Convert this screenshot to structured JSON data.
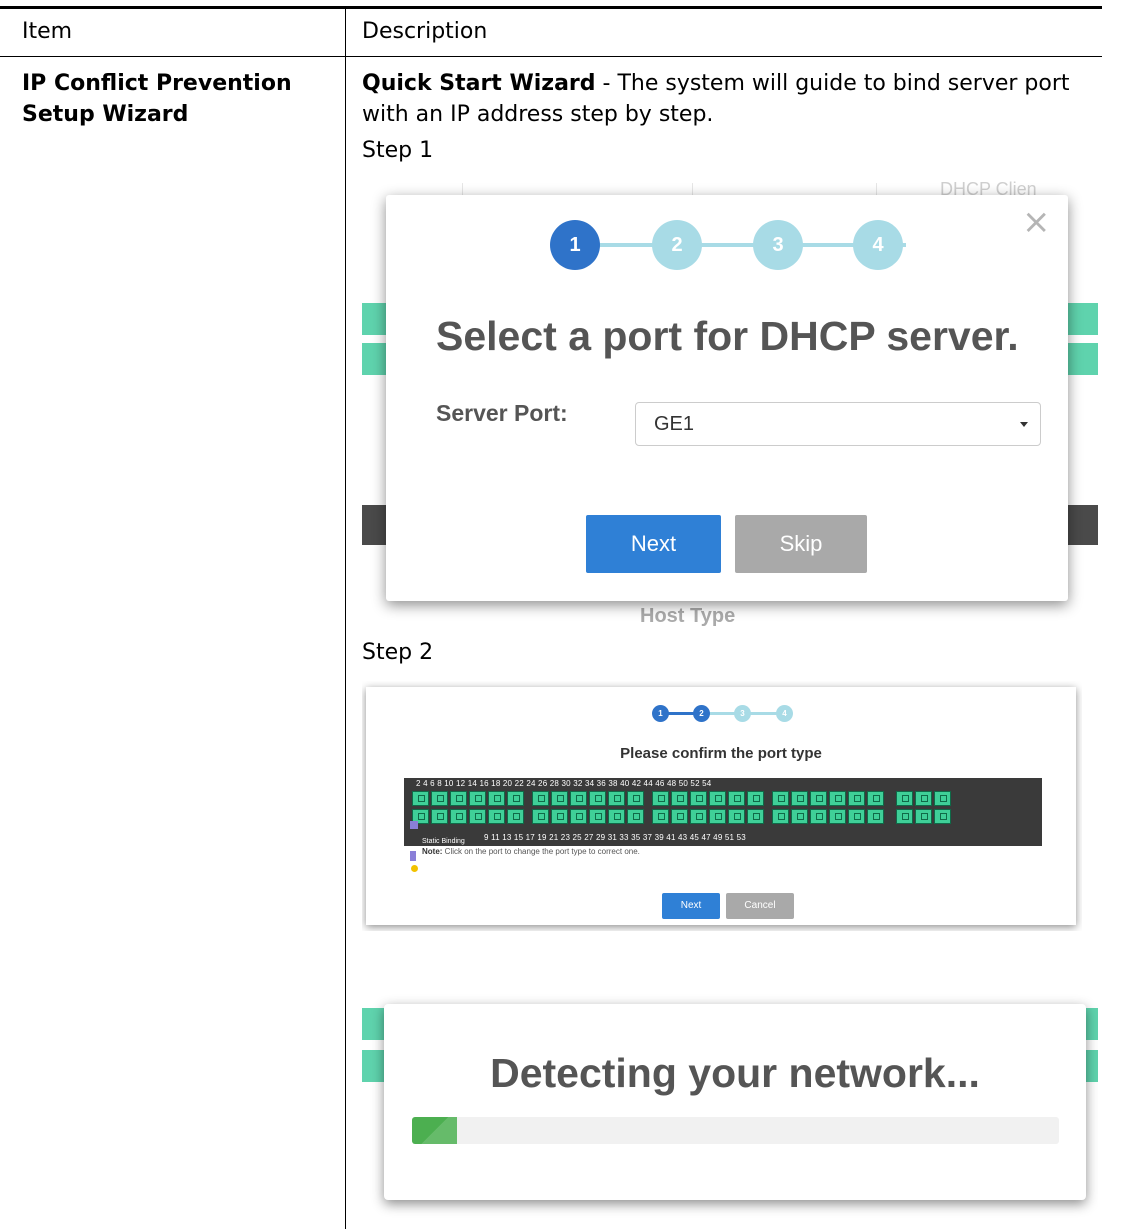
{
  "table": {
    "header_item": "Item",
    "header_description": "Description",
    "row": {
      "item": "IP Conflict Prevention Setup Wizard",
      "desc_bold": "Quick Start Wizard",
      "desc_rest": " - The system will guide to bind server port with an IP address step by step.",
      "step1_label": "Step 1",
      "step2_label": "Step 2"
    }
  },
  "step1": {
    "steps": [
      "1",
      "2",
      "3",
      "4"
    ],
    "active_step": 1,
    "title": "Select a port for DHCP server.",
    "server_port_label": "Server Port:",
    "server_port_value": "GE1",
    "next_label": "Next",
    "skip_label": "Skip",
    "background_host_type": "Host Type",
    "background_dhcp": "DHCP Clien",
    "close_glyph": "×"
  },
  "step2": {
    "steps": [
      "1",
      "2",
      "3",
      "4"
    ],
    "active_step": 2,
    "title": "Please confirm the port type",
    "top_port_numbers": "2   4   6   8  10  12    14  16  18  20  22  24    26  28  30  32  34  36    38  40  42  44  46  48    50  52  54",
    "bottom_port_numbers": "9    11    13  15  17  19  21  23    25  27  29  31  33  35    37  39  41  43  45  47    49  51  53",
    "legend_static": "Static Binding",
    "note_bold": "Note:",
    "note_text": " Click on the port to change the port type to correct one.",
    "next_label": "Next",
    "cancel_label": "Cancel"
  },
  "step3": {
    "title": "Detecting your network...",
    "progress": 0.07
  },
  "colors": {
    "active_step": "#2f73c9",
    "inactive_step": "#a8dbe6",
    "next_button": "#2f80d6",
    "skip_button": "#a9a9a9",
    "port_green": "#3fcf98",
    "progress_green": "#4caf50"
  }
}
